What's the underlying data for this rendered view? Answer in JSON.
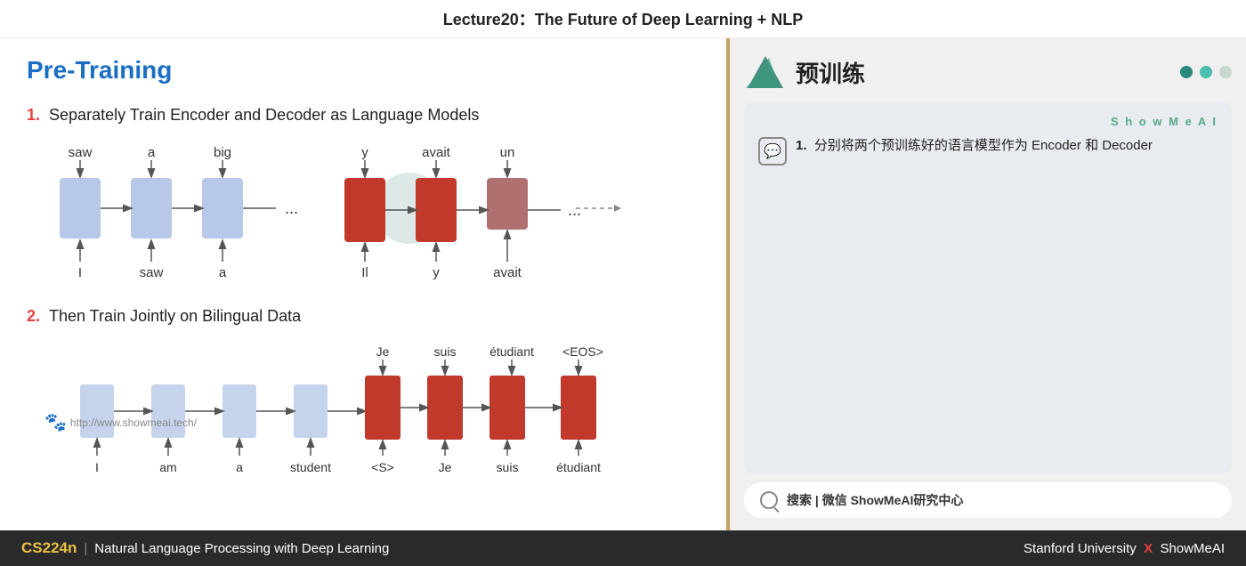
{
  "header": {
    "title": "Lecture20：The Future of Deep Learning + NLP"
  },
  "slide": {
    "title": "Pre-Training",
    "section1": {
      "number": "1.",
      "text": "Separately Train Encoder and Decoder as Language Models"
    },
    "section2": {
      "number": "2.",
      "text": "Then Train Jointly on Bilingual Data"
    },
    "diagram1": {
      "encoder_words_top": [
        "saw",
        "a",
        "big"
      ],
      "encoder_words_bottom": [
        "I",
        "saw",
        "a"
      ],
      "decoder_words_top": [
        "y",
        "avait",
        "un"
      ],
      "decoder_words_bottom": [
        "Il",
        "y",
        "avait"
      ]
    },
    "diagram2": {
      "encoder_bottom": [
        "I",
        "am",
        "a",
        "student"
      ],
      "decoder_top": [
        "Je",
        "suis",
        "étudiant",
        "<EOS>"
      ],
      "decoder_bottom": [
        "<S>",
        "Je",
        "suis",
        "étudiant"
      ]
    },
    "watermark": "http://www.showmeai.tech/"
  },
  "right_panel": {
    "title_zh": "预训练",
    "dots": [
      "#2a8a7a",
      "#4ac0b0",
      "#c8d8d0"
    ],
    "showmeai_label": "S h o w M e A I",
    "card_item": {
      "number": "1.",
      "text": "分别将两个预训练好的语言模型作为 Encoder 和 Decoder"
    },
    "search_text": "搜索 | 微信 ShowMeAI研究中心"
  },
  "footer": {
    "course": "CS224n",
    "pipe": "|",
    "description": "Natural Language Processing with Deep Learning",
    "university": "Stanford University",
    "x": "X",
    "showmeai": "ShowMeAI"
  }
}
